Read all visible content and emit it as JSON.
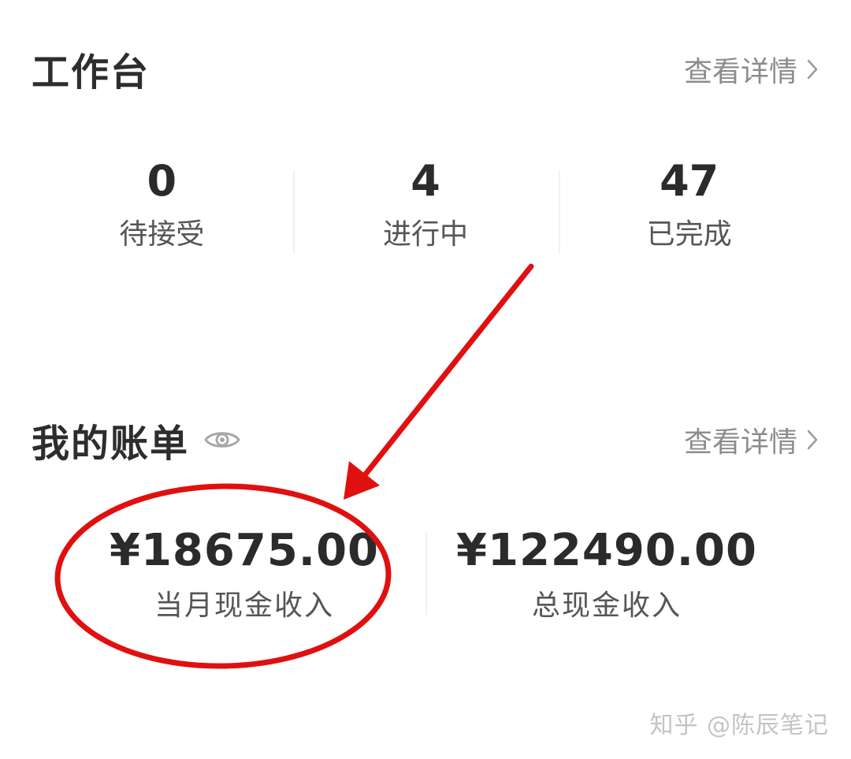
{
  "workbench": {
    "title": "工作台",
    "detail_link": "查看详情",
    "stats": [
      {
        "value": "0",
        "label": "待接受"
      },
      {
        "value": "4",
        "label": "进行中"
      },
      {
        "value": "47",
        "label": "已完成"
      }
    ]
  },
  "bill": {
    "title": "我的账单",
    "detail_link": "查看详情",
    "items": [
      {
        "value": "¥18675.00",
        "label": "当月现金收入"
      },
      {
        "value": "¥122490.00",
        "label": "总现金收入"
      }
    ]
  },
  "colors": {
    "annotation": "#e01010",
    "text_primary": "#2b2b2b",
    "text_secondary": "#8c8c8c"
  },
  "icons": {
    "eye": "eye-icon",
    "chevron": "chevron-right-icon"
  },
  "watermark": "知乎 @陈辰笔记"
}
